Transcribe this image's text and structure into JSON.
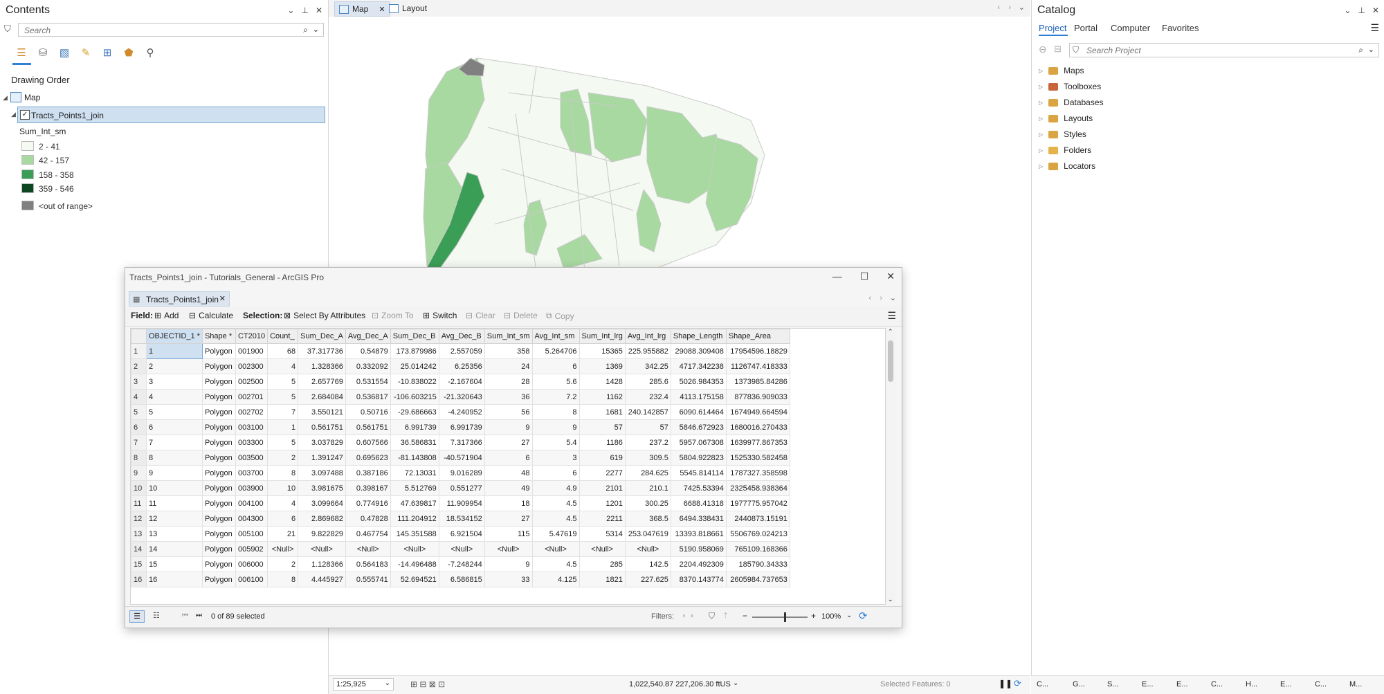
{
  "contents": {
    "title": "Contents",
    "search_placeholder": "Search",
    "drawing_order_label": "Drawing Order",
    "map_label": "Map",
    "layer_name": "Tracts_Points1_join",
    "field_label": "Sum_Int_sm",
    "legend": [
      {
        "label": "2 - 41",
        "color": "#f4f9f2"
      },
      {
        "label": "42 - 157",
        "color": "#a8d9a0"
      },
      {
        "label": "158 - 358",
        "color": "#3b9e57"
      },
      {
        "label": "359 - 546",
        "color": "#0d4620"
      },
      {
        "label": "<out of range>",
        "color": "#808080"
      }
    ]
  },
  "map_tabs": [
    {
      "label": "Map",
      "active": true
    },
    {
      "label": "Layout",
      "active": false
    }
  ],
  "map_status": {
    "scale": "1:25,925",
    "coords": "1,022,540.87 227,206.30 ftUS",
    "selected_features": "Selected Features: 0"
  },
  "catalog": {
    "title": "Catalog",
    "tabs": [
      "Project",
      "Portal",
      "Computer",
      "Favorites"
    ],
    "search_placeholder": "Search Project",
    "items": [
      {
        "label": "Maps",
        "color": "#d9a441"
      },
      {
        "label": "Toolboxes",
        "color": "#c9643b"
      },
      {
        "label": "Databases",
        "color": "#d9a441"
      },
      {
        "label": "Layouts",
        "color": "#d9a441"
      },
      {
        "label": "Styles",
        "color": "#d9a441"
      },
      {
        "label": "Folders",
        "color": "#e4b34a"
      },
      {
        "label": "Locators",
        "color": "#d9a441"
      }
    ]
  },
  "attr_window": {
    "title": "Tracts_Points1_join - Tutorials_General - ArcGIS Pro",
    "tab_label": "Tracts_Points1_join",
    "toolbar": {
      "field_label": "Field:",
      "add": "Add",
      "calculate": "Calculate",
      "selection_label": "Selection:",
      "select_by_attributes": "Select By Attributes",
      "zoom_to": "Zoom To",
      "switch": "Switch",
      "clear": "Clear",
      "delete": "Delete",
      "copy": "Copy"
    },
    "columns": [
      "OBJECTID_1 *",
      "Shape *",
      "CT2010",
      "Count_",
      "Sum_Dec_A",
      "Avg_Dec_A",
      "Sum_Dec_B",
      "Avg_Dec_B",
      "Sum_Int_sm",
      "Avg_Int_sm",
      "Sum_Int_lrg",
      "Avg_Int_lrg",
      "Shape_Length",
      "Shape_Area"
    ],
    "rows": [
      [
        "1",
        "1",
        "Polygon",
        "001900",
        "68",
        "37.317736",
        "0.54879",
        "173.879986",
        "2.557059",
        "358",
        "5.264706",
        "15365",
        "225.955882",
        "29088.309408",
        "17954596.18829"
      ],
      [
        "2",
        "2",
        "Polygon",
        "002300",
        "4",
        "1.328366",
        "0.332092",
        "25.014242",
        "6.25356",
        "24",
        "6",
        "1369",
        "342.25",
        "4717.342238",
        "1126747.418333"
      ],
      [
        "3",
        "3",
        "Polygon",
        "002500",
        "5",
        "2.657769",
        "0.531554",
        "-10.838022",
        "-2.167604",
        "28",
        "5.6",
        "1428",
        "285.6",
        "5026.984353",
        "1373985.84286"
      ],
      [
        "4",
        "4",
        "Polygon",
        "002701",
        "5",
        "2.684084",
        "0.536817",
        "-106.603215",
        "-21.320643",
        "36",
        "7.2",
        "1162",
        "232.4",
        "4113.175158",
        "877836.909033"
      ],
      [
        "5",
        "5",
        "Polygon",
        "002702",
        "7",
        "3.550121",
        "0.50716",
        "-29.686663",
        "-4.240952",
        "56",
        "8",
        "1681",
        "240.142857",
        "6090.614464",
        "1674949.664594"
      ],
      [
        "6",
        "6",
        "Polygon",
        "003100",
        "1",
        "0.561751",
        "0.561751",
        "6.991739",
        "6.991739",
        "9",
        "9",
        "57",
        "57",
        "5846.672923",
        "1680016.270433"
      ],
      [
        "7",
        "7",
        "Polygon",
        "003300",
        "5",
        "3.037829",
        "0.607566",
        "36.586831",
        "7.317366",
        "27",
        "5.4",
        "1186",
        "237.2",
        "5957.067308",
        "1639977.867353"
      ],
      [
        "8",
        "8",
        "Polygon",
        "003500",
        "2",
        "1.391247",
        "0.695623",
        "-81.143808",
        "-40.571904",
        "6",
        "3",
        "619",
        "309.5",
        "5804.922823",
        "1525330.582458"
      ],
      [
        "9",
        "9",
        "Polygon",
        "003700",
        "8",
        "3.097488",
        "0.387186",
        "72.13031",
        "9.016289",
        "48",
        "6",
        "2277",
        "284.625",
        "5545.814114",
        "1787327.358598"
      ],
      [
        "10",
        "10",
        "Polygon",
        "003900",
        "10",
        "3.981675",
        "0.398167",
        "5.512769",
        "0.551277",
        "49",
        "4.9",
        "2101",
        "210.1",
        "7425.53394",
        "2325458.938364"
      ],
      [
        "11",
        "11",
        "Polygon",
        "004100",
        "4",
        "3.099664",
        "0.774916",
        "47.639817",
        "11.909954",
        "18",
        "4.5",
        "1201",
        "300.25",
        "6688.41318",
        "1977775.957042"
      ],
      [
        "12",
        "12",
        "Polygon",
        "004300",
        "6",
        "2.869682",
        "0.47828",
        "111.204912",
        "18.534152",
        "27",
        "4.5",
        "2211",
        "368.5",
        "6494.338431",
        "2440873.15191"
      ],
      [
        "13",
        "13",
        "Polygon",
        "005100",
        "21",
        "9.822829",
        "0.467754",
        "145.351588",
        "6.921504",
        "115",
        "5.47619",
        "5314",
        "253.047619",
        "13393.818661",
        "5506769.024213"
      ],
      [
        "14",
        "14",
        "Polygon",
        "005902",
        "<Null>",
        "<Null>",
        "<Null>",
        "<Null>",
        "<Null>",
        "<Null>",
        "<Null>",
        "<Null>",
        "<Null>",
        "5190.958069",
        "765109.168366"
      ],
      [
        "15",
        "15",
        "Polygon",
        "006000",
        "2",
        "1.128366",
        "0.564183",
        "-14.496488",
        "-7.248244",
        "9",
        "4.5",
        "285",
        "142.5",
        "2204.492309",
        "185790.34333"
      ],
      [
        "16",
        "16",
        "Polygon",
        "006100",
        "8",
        "4.445927",
        "0.555741",
        "52.694521",
        "6.586815",
        "33",
        "4.125",
        "1821",
        "227.625",
        "8370.143774",
        "2605984.737653"
      ]
    ],
    "selected_text": "0 of 89 selected",
    "filters_label": "Filters:",
    "zoom_level": "100%"
  },
  "dock_tabs": [
    "C...",
    "G...",
    "S...",
    "E...",
    "E...",
    "C...",
    "H...",
    "E...",
    "C...",
    "M..."
  ]
}
